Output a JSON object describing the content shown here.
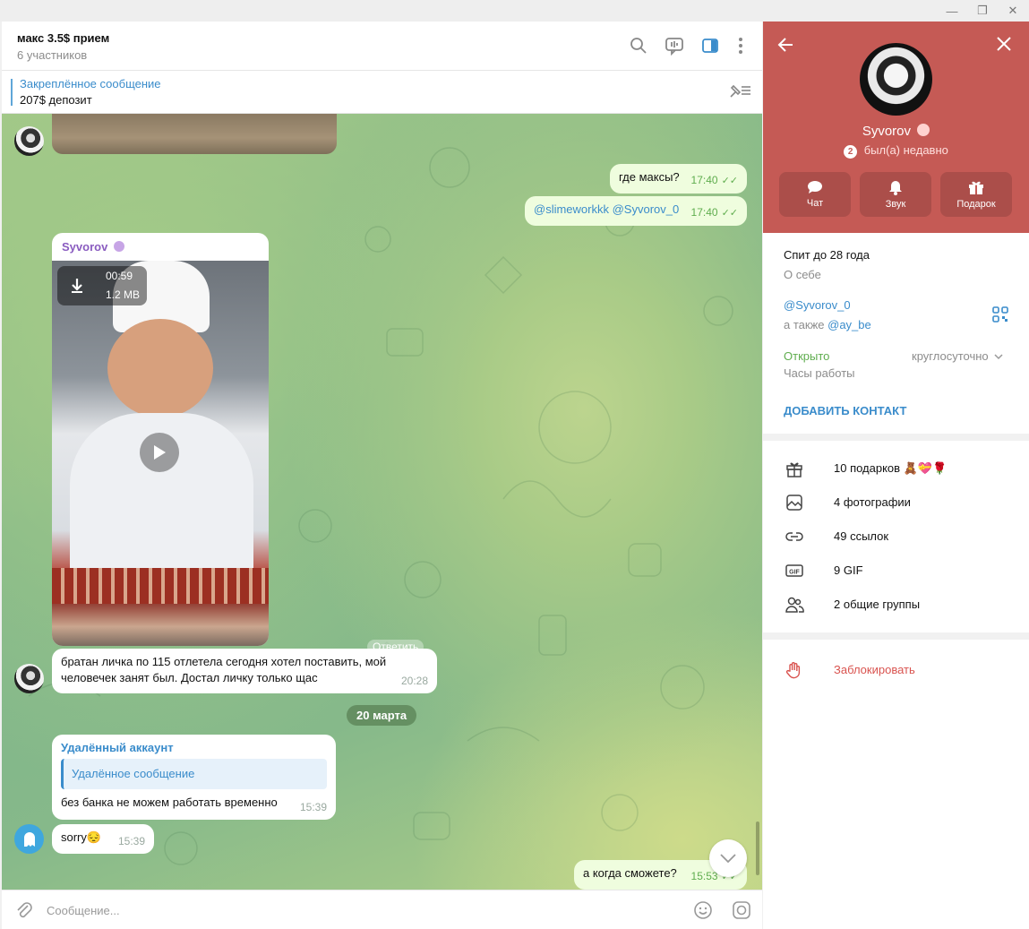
{
  "window": {
    "minimize": "—",
    "restore": "❐",
    "close": "✕"
  },
  "chat": {
    "title": "макс 3.5$ прием",
    "subtitle": "6 участников",
    "pinned_title": "Закреплённое сообщение",
    "pinned_text": "207$ депозит"
  },
  "messages": {
    "m1_text": "где максы?",
    "m1_time": "17:40",
    "m2_text": "@slimeworkkk @Syvorov_0",
    "m2_time": "17:40",
    "video_sender": "Syvorov",
    "video_duration": "00:59",
    "video_size": "1.2 MB",
    "reply_hint": "Ответить",
    "m3_text": "братан личка по 115 отлетела сегодня хотел поставить, мой человечек занят был. Достал личку только щас",
    "m3_time": "20:28",
    "date_pill": "20 марта",
    "m4_sender": "Удалённый аккаунт",
    "m4_quote": "Удалённое сообщение",
    "m4_text": "без банка не можем работать временно",
    "m4_time": "15:39",
    "m5_text": "sorry😔",
    "m5_time": "15:39",
    "m6_text": "а когда сможете?",
    "m6_time": "15:53"
  },
  "composer": {
    "placeholder": "Сообщение..."
  },
  "profile": {
    "name": "Syvorov",
    "status_badge": "2",
    "status": "был(а) недавно",
    "buttons": [
      {
        "label": "Чат"
      },
      {
        "label": "Звук"
      },
      {
        "label": "Подарок"
      }
    ],
    "bio": "Спит до 28 года",
    "bio_label": "О себе",
    "username": "@Syvorov_0",
    "also_prefix": "а также",
    "also_username": "@ay_be",
    "hours_status": "Открыто",
    "hours_value": "круглосуточно",
    "hours_label": "Часы работы",
    "add_contact": "ДОБАВИТЬ КОНТАКТ",
    "media": [
      {
        "label": "10 подарков 🧸💝🌹",
        "icon": "gift-icon"
      },
      {
        "label": "4 фотографии",
        "icon": "photo-icon"
      },
      {
        "label": "49 ссылок",
        "icon": "link-icon"
      },
      {
        "label": "9 GIF",
        "icon": "gif-icon"
      },
      {
        "label": "2 общие группы",
        "icon": "groups-icon"
      }
    ],
    "block": "Заблокировать"
  },
  "colors": {
    "accent": "#3a8ccb",
    "profile_header": "#c55a55",
    "out_bubble": "#effdde",
    "danger": "#d9534f",
    "online": "#5fad4e"
  }
}
